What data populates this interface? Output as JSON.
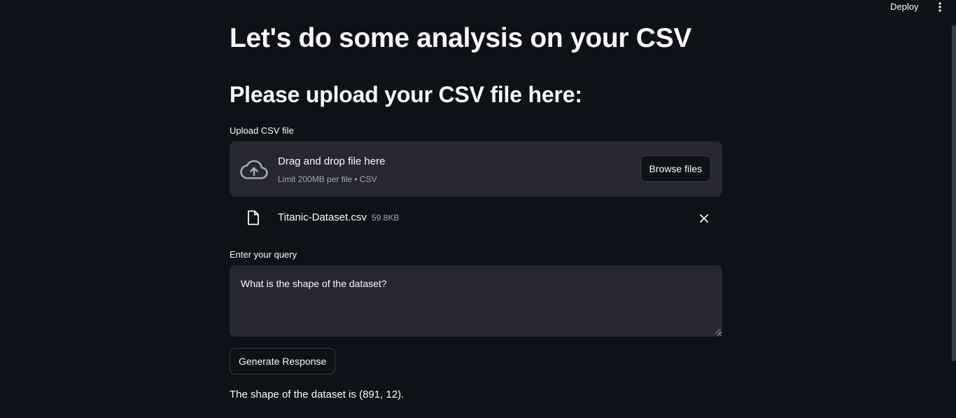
{
  "header": {
    "deploy_label": "Deploy",
    "menu_icon": "kebab-menu-icon"
  },
  "main": {
    "title": "Let's do some analysis on your CSV",
    "subtitle": "Please upload your CSV file here:"
  },
  "uploader": {
    "label": "Upload CSV file",
    "drop_text": "Drag and drop file here",
    "limit_text": "Limit 200MB per file • CSV",
    "browse_label": "Browse files",
    "upload_icon": "cloud-upload-icon"
  },
  "uploaded_file": {
    "name": "Titanic-Dataset.csv",
    "size": "59.8KB",
    "file_icon": "file-icon",
    "remove_icon": "close-icon"
  },
  "query": {
    "label": "Enter your query",
    "value": "What is the shape of the dataset?"
  },
  "generate_label": "Generate Response",
  "response_text": "The shape of the dataset is (891, 12).",
  "colors": {
    "background": "#0e1117",
    "surface": "#262730",
    "text": "#fafafa",
    "muted_text": "#a3a8b8"
  }
}
